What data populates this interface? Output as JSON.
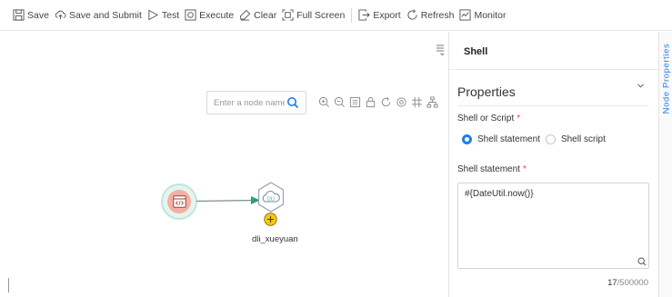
{
  "toolbar": {
    "items": [
      {
        "label": "Save",
        "icon": "save-icon"
      },
      {
        "label": "Save and Submit",
        "icon": "cloud-upload-icon"
      },
      {
        "label": "Test",
        "icon": "play-icon"
      },
      {
        "label": "Execute",
        "icon": "execute-icon"
      },
      {
        "label": "Clear",
        "icon": "eraser-icon"
      },
      {
        "label": "Full Screen",
        "icon": "fullscreen-icon"
      },
      {
        "label": "Export",
        "icon": "export-icon"
      },
      {
        "label": "Refresh",
        "icon": "refresh-icon"
      },
      {
        "label": "Monitor",
        "icon": "monitor-icon"
      }
    ]
  },
  "canvas": {
    "search_placeholder": "Enter a node name.",
    "tools": [
      "zoom-in-icon",
      "zoom-out-icon",
      "fit-icon",
      "lock-icon",
      "rotate-icon",
      "location-icon",
      "grid-icon",
      "layout-icon"
    ],
    "nodes": [
      {
        "type": "shell",
        "icon": "code-icon",
        "label": ""
      },
      {
        "type": "dli",
        "icon": "cloud-dli-icon",
        "label": "dli_xueyuan",
        "badge_icon": "add-icon"
      }
    ]
  },
  "panel": {
    "title": "Shell",
    "section_title": "Properties",
    "shell_or_script": {
      "label": "Shell or Script",
      "required_mark": "*",
      "options": [
        "Shell statement",
        "Shell script"
      ],
      "selected": "Shell statement"
    },
    "statement": {
      "label": "Shell statement",
      "required_mark": "*",
      "value": "#{DateUtil.now()}",
      "count": "17",
      "max": "/500000"
    }
  },
  "side_tab": {
    "label": "Node Properties"
  },
  "colors": {
    "accent": "#1f7ee8",
    "required": "#e0493e",
    "node_ring": "#c2e5d9",
    "node_fill": "#f6b0a3",
    "edge": "#2e9e83",
    "badge": "#f5c518"
  }
}
